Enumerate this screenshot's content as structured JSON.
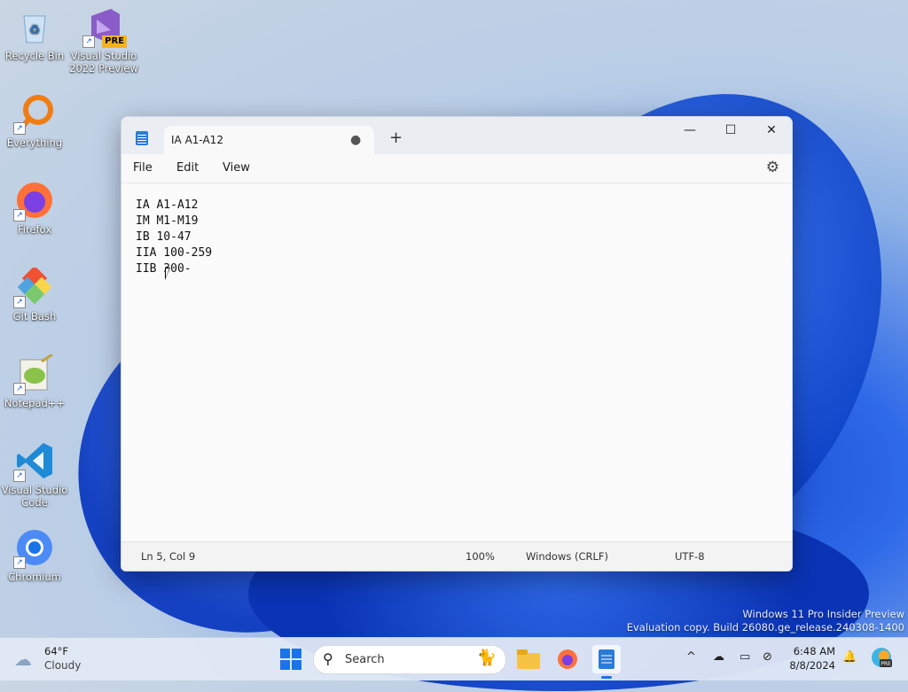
{
  "desktop": {
    "icons": [
      {
        "label": "Recycle Bin",
        "icon": "recycle-bin-icon"
      },
      {
        "label": "Visual Studio 2022 Preview",
        "icon": "visual-studio-icon",
        "badge": "PRE"
      },
      {
        "label": "Everything",
        "icon": "everything-search-icon"
      },
      {
        "label": "Firefox",
        "icon": "firefox-icon"
      },
      {
        "label": "Git Bash",
        "icon": "git-bash-icon"
      },
      {
        "label": "Notepad++",
        "icon": "notepad-plus-plus-icon"
      },
      {
        "label": "Visual Studio Code",
        "icon": "vscode-icon"
      },
      {
        "label": "Chromium",
        "icon": "chromium-icon"
      }
    ],
    "watermark_line1": "Windows 11 Pro Insider Preview",
    "watermark_line2": "Evaluation copy. Build 26080.ge_release.240308-1400"
  },
  "notepad": {
    "tab_title": "IA A1-A12",
    "unsaved_indicator": "●",
    "new_tab_symbol": "+",
    "menu": [
      "File",
      "Edit",
      "View"
    ],
    "lines": [
      "IA A1-A12",
      "IM M1-M19",
      "IB 10-47",
      "IIA 100-259",
      "IIB 300-"
    ],
    "status": {
      "position": "Ln 5, Col 9",
      "zoom": "100%",
      "line_ending": "Windows (CRLF)",
      "encoding": "UTF-8"
    },
    "window_controls": {
      "minimize": "—",
      "maximize": "☐",
      "close": "✕"
    }
  },
  "taskbar": {
    "weather": {
      "temp": "64°F",
      "condition": "Cloudy"
    },
    "search_label": "Search",
    "clock": {
      "time": "6:48 AM",
      "date": "8/8/2024"
    },
    "pinned": [
      "start-icon",
      "search-icon",
      "file-explorer-icon",
      "firefox-icon",
      "notepad-icon"
    ],
    "tray": [
      "chevron-up-icon",
      "onedrive-icon",
      "display-icon",
      "network-icon",
      "notification-bell-icon",
      "copilot-icon"
    ]
  },
  "colors": {
    "accent": "#2b7bd8",
    "wallpaper_blue": "#0b3fc4"
  }
}
